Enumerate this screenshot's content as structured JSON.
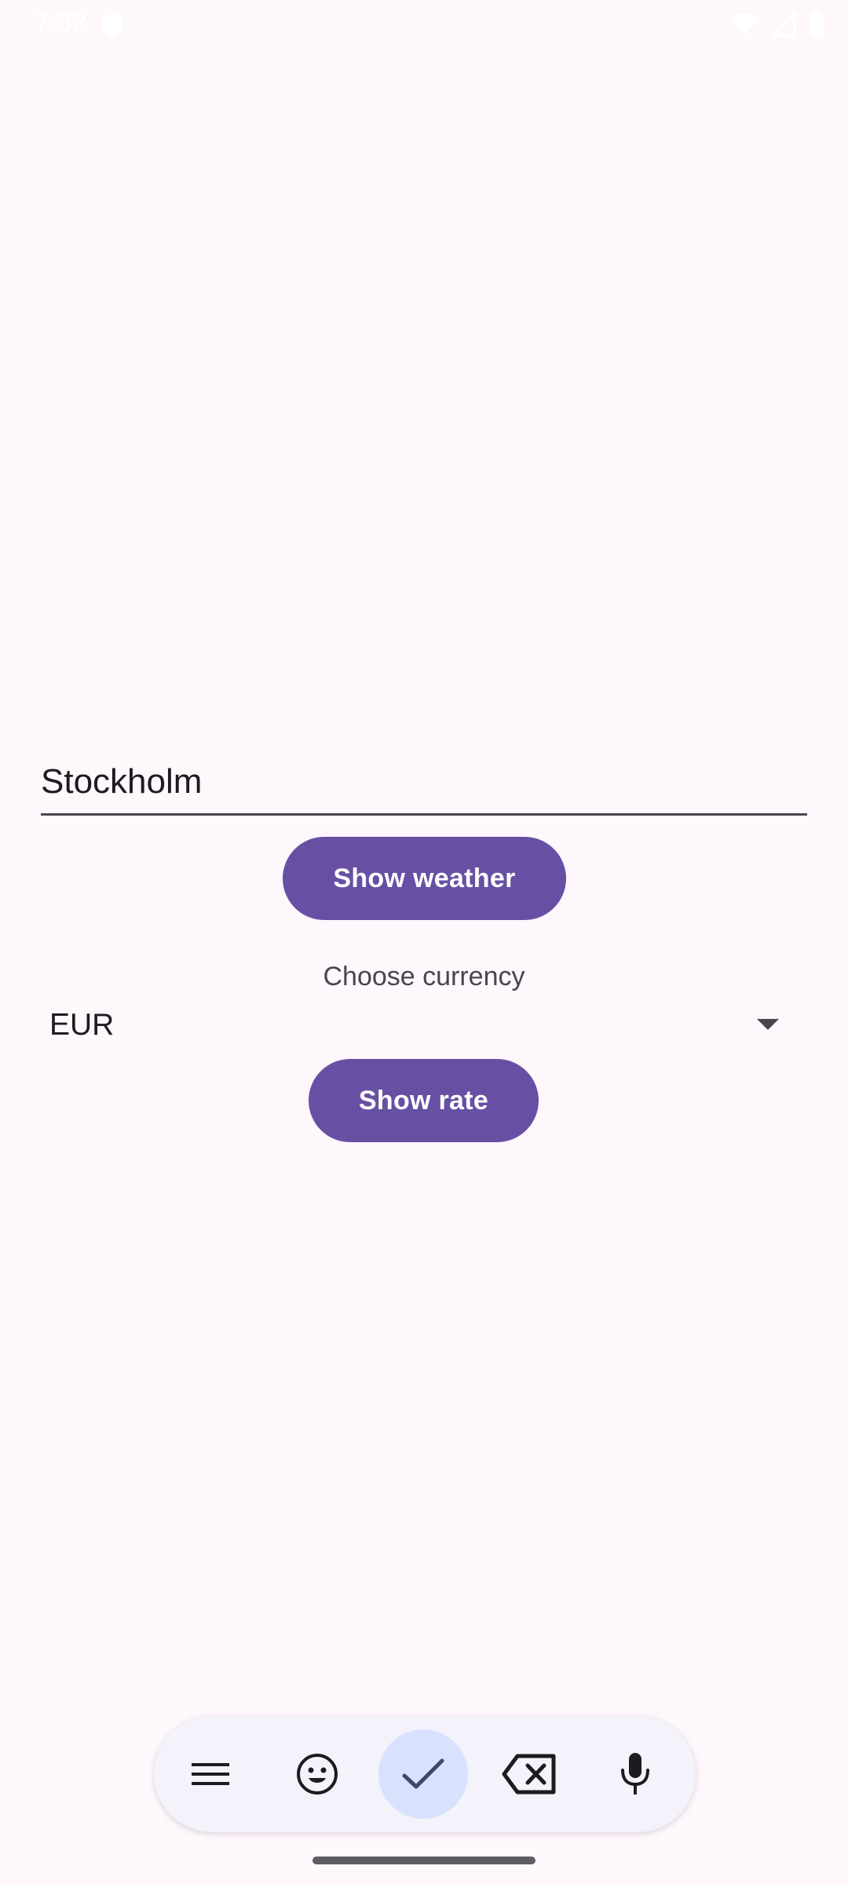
{
  "status_bar": {
    "time": "7:32"
  },
  "city_input": {
    "value": "Stockholm"
  },
  "buttons": {
    "show_weather": "Show weather",
    "show_rate": "Show rate"
  },
  "currency": {
    "label": "Choose currency",
    "selected": "EUR"
  },
  "toolbar": {
    "items": [
      "menu-icon",
      "emoji-icon",
      "check-icon",
      "backspace-icon",
      "mic-icon"
    ],
    "active_item": "check-icon"
  },
  "colors": {
    "background": "#FEF7FC",
    "primary": "#6750A4",
    "on_primary": "#FFFFFF",
    "toolbar_bg": "#F4F2FA",
    "active_tool_bg": "#D8E2FF"
  }
}
